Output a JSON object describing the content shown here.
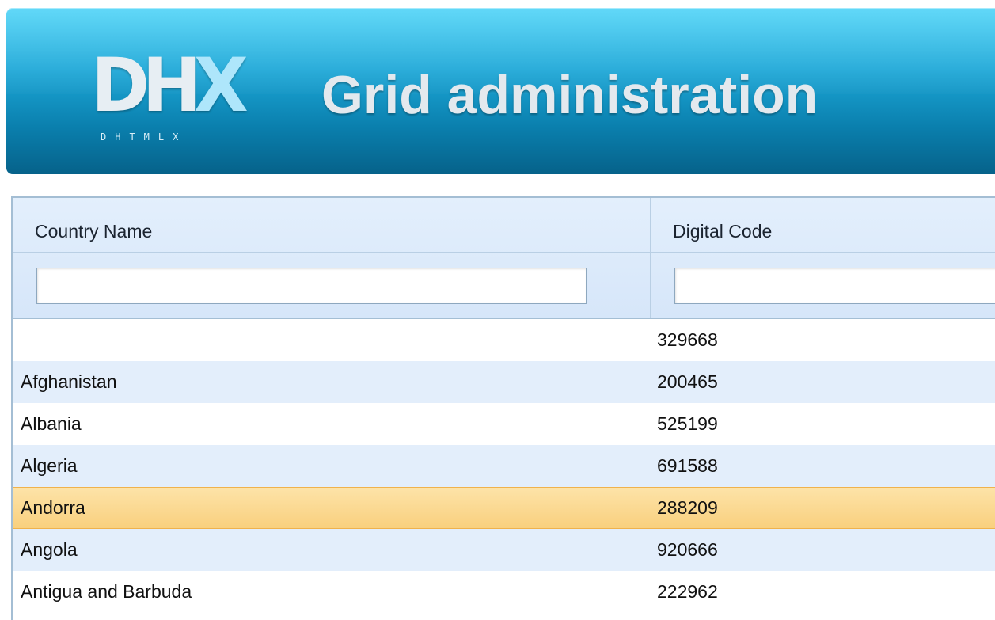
{
  "header": {
    "logo_text": "DHX",
    "logo_letters": [
      "D",
      "H",
      "X"
    ],
    "logo_subtext": "DHTMLX",
    "title": "Grid administration",
    "colors": {
      "gradient_top": "#3fd0f7",
      "gradient_bottom": "#06628a",
      "title_text": "#e3e9ee"
    }
  },
  "grid": {
    "columns": [
      {
        "label": "Country Name"
      },
      {
        "label": "Digital Code"
      }
    ],
    "filters": [
      {
        "value": "",
        "placeholder": ""
      },
      {
        "value": "",
        "placeholder": ""
      }
    ],
    "rows": [
      {
        "name": "",
        "code": "329668",
        "selected": false
      },
      {
        "name": "Afghanistan",
        "code": "200465",
        "selected": false
      },
      {
        "name": "Albania",
        "code": "525199",
        "selected": false
      },
      {
        "name": "Algeria",
        "code": "691588",
        "selected": false
      },
      {
        "name": "Andorra",
        "code": "288209",
        "selected": true
      },
      {
        "name": "Angola",
        "code": "920666",
        "selected": false
      },
      {
        "name": "Antigua and Barbuda",
        "code": "222962",
        "selected": false
      }
    ],
    "colors": {
      "header_bg": "#d6e6f9",
      "row_alt_bg": "#e3eefb",
      "selected_bg": "#f9d07e",
      "border": "#a4bed4"
    }
  }
}
